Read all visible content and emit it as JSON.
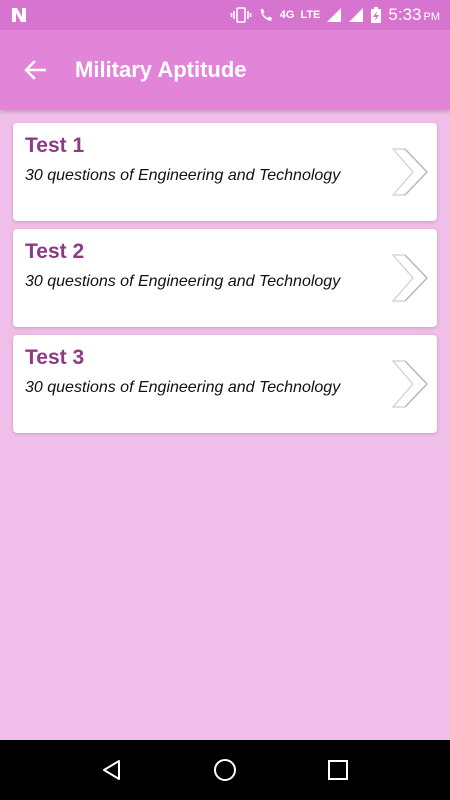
{
  "status_bar": {
    "network_label": "4G",
    "lte_label": "LTE",
    "time": "5:33",
    "ampm": "PM"
  },
  "app_bar": {
    "title": "Military Aptitude"
  },
  "tests": [
    {
      "title": "Test 1",
      "description": "30 questions of Engineering and Technology"
    },
    {
      "title": "Test 2",
      "description": "30 questions of Engineering and Technology"
    },
    {
      "title": "Test 3",
      "description": "30 questions of Engineering and Technology"
    }
  ],
  "colors": {
    "status_bar": "#d774cf",
    "app_bar": "#e285d9",
    "background": "#f0bfe9",
    "title_text": "#8e3a86"
  }
}
